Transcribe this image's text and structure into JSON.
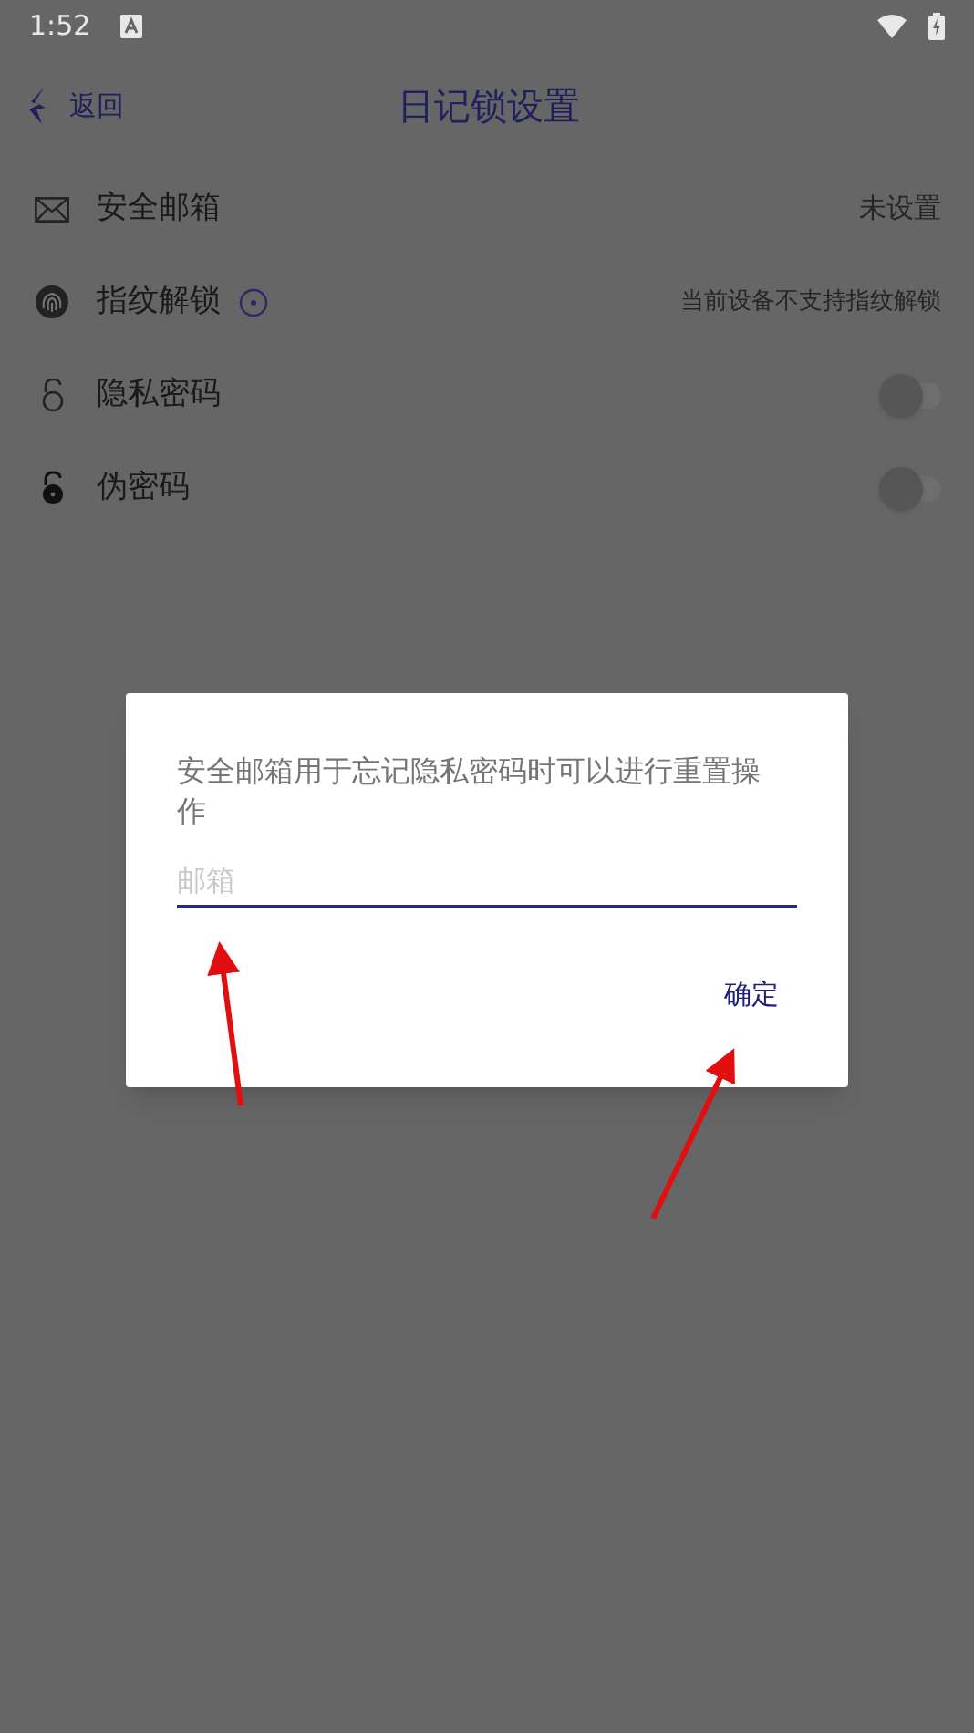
{
  "status_bar": {
    "time": "1:52"
  },
  "header": {
    "back": "返回",
    "title": "日记锁设置"
  },
  "rows": [
    {
      "kind": "value",
      "label": "安全邮箱",
      "value": "未设置"
    },
    {
      "kind": "value",
      "label": "指纹解锁",
      "info": true,
      "value": "当前设备不支持指纹解锁"
    },
    {
      "kind": "toggle",
      "label": "隐私密码",
      "on": false
    },
    {
      "kind": "toggle",
      "label": "伪密码",
      "on": false
    }
  ],
  "dialog": {
    "message": "安全邮箱用于忘记隐私密码时可以进行重置操作",
    "email_field": {
      "placeholder": "邮箱"
    },
    "confirm": "确定"
  }
}
